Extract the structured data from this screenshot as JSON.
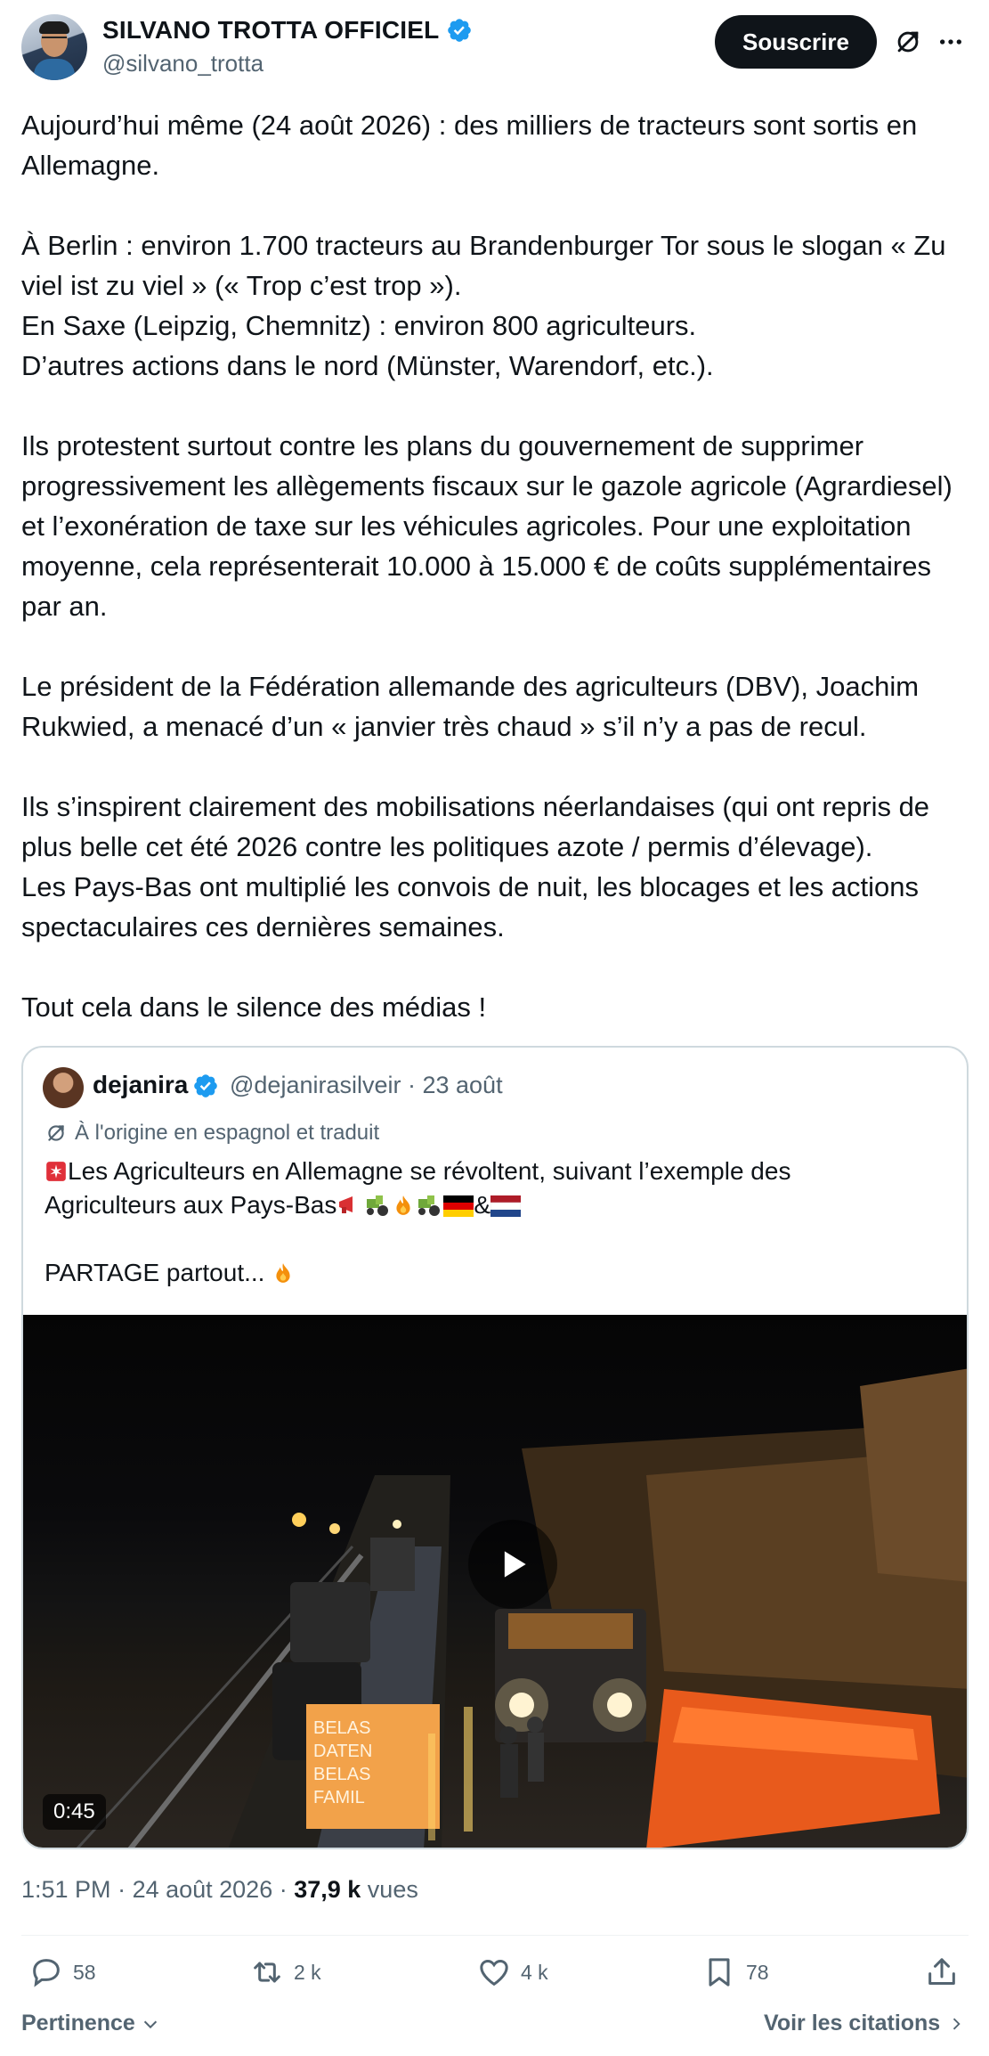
{
  "author": {
    "display_name": "SILVANO TROTTA OFFICIEL",
    "handle": "@silvano_trotta",
    "verified": true
  },
  "header": {
    "subscribe_label": "Souscrire",
    "translate_icon": "translate-icon",
    "more_icon": "more-icon"
  },
  "post": {
    "paragraphs": [
      "Aujourd’hui même (24 août 2026) : des milliers de tracteurs sont sortis en Allemagne.",
      "À Berlin : environ 1.700 tracteurs au Brandenburger Tor sous le slogan « Zu viel ist zu viel » (« Trop c’est trop »).",
      "En Saxe (Leipzig, Chemnitz) : environ 800 agriculteurs.",
      "D’autres actions dans le nord (Münster, Warendorf, etc.).",
      "Ils protestent surtout contre les plans du gouvernement de supprimer progressivement les allègements fiscaux sur le gazole agricole (Agrardiesel) et l’exonération de taxe sur les véhicules agricoles. Pour une exploitation moyenne, cela représenterait 10.000 à 15.000 € de coûts supplémentaires par an.",
      "Le président de la Fédération allemande des agriculteurs (DBV), Joachim Rukwied, a menacé d’un « janvier très chaud » s’il n’y a pas de recul.",
      "Ils s’inspirent clairement des mobilisations néerlandaises (qui ont repris de plus belle cet été 2026 contre les politiques azote / permis d’élevage).",
      "Les Pays-Bas ont multiplié les convois de nuit, les blocages et les actions spectaculaires ces dernières semaines.",
      "Tout cela dans le silence des médias !"
    ]
  },
  "quote": {
    "display_name": "dejanira",
    "handle": "@dejanirasilveir",
    "separator": " · ",
    "date": "23 août",
    "translated_note": "À l'origine en espagnol et traduit",
    "line1": "Les Agriculteurs en Allemagne se révoltent, suivant l’exemple des",
    "line2": "Agriculteurs aux Pays-Bas",
    "line2_connector": "&",
    "line3": "PARTAGE partout... ",
    "video_duration": "0:45",
    "video_sign": "BELAS DATEN BELAS FAMIL"
  },
  "meta": {
    "time": "1:51 PM",
    "separator": " · ",
    "date": "24 août 2026",
    "separator2": " · ",
    "views_count": "37,9 k",
    "views_label": " vues"
  },
  "actions": {
    "replies": "58",
    "reposts": "2 k",
    "likes": "4 k",
    "bookmarks": "78"
  },
  "footer": {
    "sort_label": "Pertinence",
    "see_quotes_label": "Voir les citations"
  },
  "colors": {
    "text": "#0f1419",
    "secondary": "#536471",
    "verified": "#1d9bf0",
    "border": "#cfd9de"
  }
}
